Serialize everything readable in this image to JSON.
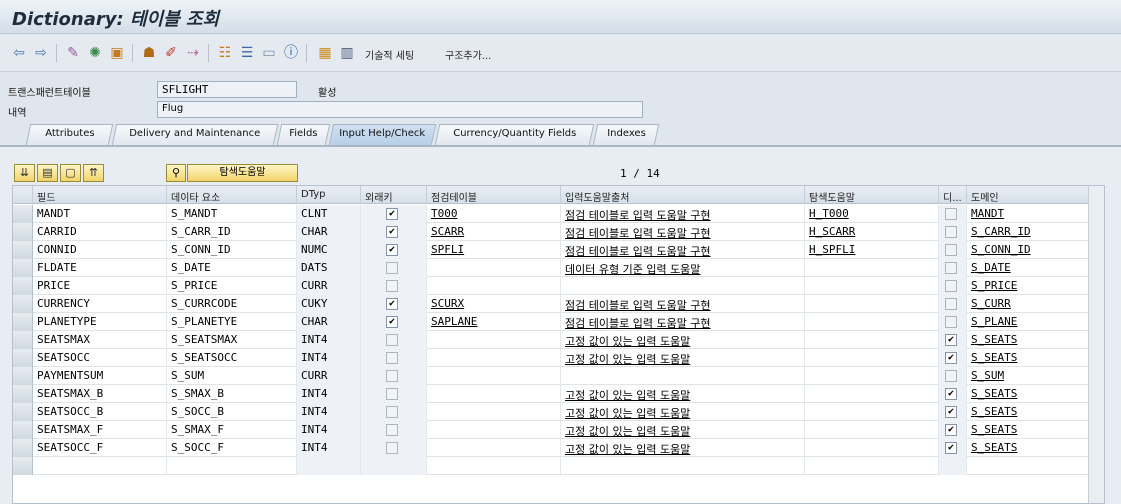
{
  "title": "Dictionary: 테이블 조회",
  "toolbar": {
    "items": [
      "back",
      "forward",
      "display-change",
      "activate",
      "where-used",
      "other-object",
      "check",
      "navigate",
      "object-list",
      "hierarchy",
      "info",
      "technical-settings",
      "append-structure"
    ],
    "tech_settings_label": "기술적 세팅",
    "append_structure_label": "구조추가..."
  },
  "header": {
    "transparent_table_label": "트랜스패런트테이블",
    "table_name": "SFLIGHT",
    "status": "활성",
    "desc_label": "내역",
    "desc_value": "Flug"
  },
  "tabs": [
    {
      "label": "Attributes"
    },
    {
      "label": "Delivery and Maintenance"
    },
    {
      "label": "Fields"
    },
    {
      "label": "Input Help/Check",
      "active": true
    },
    {
      "label": "Currency/Quantity Fields"
    },
    {
      "label": "Indexes"
    }
  ],
  "panel": {
    "search_help_label": "탐색도움말",
    "pager": "1 / 14"
  },
  "grid": {
    "columns": [
      "필드",
      "데이타 요소",
      "DTyp",
      "외래키",
      "점검테이블",
      "입력도움말출처",
      "탐색도움말",
      "디...",
      "도메인"
    ],
    "rows": [
      {
        "field": "MANDT",
        "element": "S_MANDT",
        "dtyp": "CLNT",
        "fk": true,
        "check": "T000",
        "origin": "점검 테이블로 입력 도움말 구현",
        "searchhelp": "H_T000",
        "deflt": false,
        "domain": "MANDT"
      },
      {
        "field": "CARRID",
        "element": "S_CARR_ID",
        "dtyp": "CHAR",
        "fk": true,
        "check": "SCARR",
        "origin": "점검 테이블로 입력 도움말 구현",
        "searchhelp": "H_SCARR",
        "deflt": false,
        "domain": "S_CARR_ID"
      },
      {
        "field": "CONNID",
        "element": "S_CONN_ID",
        "dtyp": "NUMC",
        "fk": true,
        "check": "SPFLI",
        "origin": "점검 테이블로 입력 도움말 구현",
        "searchhelp": "H_SPFLI",
        "deflt": false,
        "domain": "S_CONN_ID"
      },
      {
        "field": "FLDATE",
        "element": "S_DATE",
        "dtyp": "DATS",
        "fk": false,
        "check": "",
        "origin": "데이터 유형 기준 입력 도움말",
        "searchhelp": "",
        "deflt": false,
        "domain": "S_DATE"
      },
      {
        "field": "PRICE",
        "element": "S_PRICE",
        "dtyp": "CURR",
        "fk": false,
        "check": "",
        "origin": "",
        "searchhelp": "",
        "deflt": false,
        "domain": "S_PRICE"
      },
      {
        "field": "CURRENCY",
        "element": "S_CURRCODE",
        "dtyp": "CUKY",
        "fk": true,
        "check": "SCURX",
        "origin": "점검 테이블로 입력 도움말 구현",
        "searchhelp": "",
        "deflt": false,
        "domain": "S_CURR"
      },
      {
        "field": "PLANETYPE",
        "element": "S_PLANETYE",
        "dtyp": "CHAR",
        "fk": true,
        "check": "SAPLANE",
        "origin": "점검 테이블로 입력 도움말 구현",
        "searchhelp": "",
        "deflt": false,
        "domain": "S_PLANE"
      },
      {
        "field": "SEATSMAX",
        "element": "S_SEATSMAX",
        "dtyp": "INT4",
        "fk": false,
        "check": "",
        "origin": "고정 값이 있는 입력 도움말",
        "searchhelp": "",
        "deflt": true,
        "domain": "S_SEATS"
      },
      {
        "field": "SEATSOCC",
        "element": "S_SEATSOCC",
        "dtyp": "INT4",
        "fk": false,
        "check": "",
        "origin": "고정 값이 있는 입력 도움말",
        "searchhelp": "",
        "deflt": true,
        "domain": "S_SEATS"
      },
      {
        "field": "PAYMENTSUM",
        "element": "S_SUM",
        "dtyp": "CURR",
        "fk": false,
        "check": "",
        "origin": "",
        "searchhelp": "",
        "deflt": false,
        "domain": "S_SUM"
      },
      {
        "field": "SEATSMAX_B",
        "element": "S_SMAX_B",
        "dtyp": "INT4",
        "fk": false,
        "check": "",
        "origin": "고정 값이 있는 입력 도움말",
        "searchhelp": "",
        "deflt": true,
        "domain": "S_SEATS"
      },
      {
        "field": "SEATSOCC_B",
        "element": "S_SOCC_B",
        "dtyp": "INT4",
        "fk": false,
        "check": "",
        "origin": "고정 값이 있는 입력 도움말",
        "searchhelp": "",
        "deflt": true,
        "domain": "S_SEATS"
      },
      {
        "field": "SEATSMAX_F",
        "element": "S_SMAX_F",
        "dtyp": "INT4",
        "fk": false,
        "check": "",
        "origin": "고정 값이 있는 입력 도움말",
        "searchhelp": "",
        "deflt": true,
        "domain": "S_SEATS"
      },
      {
        "field": "SEATSOCC_F",
        "element": "S_SOCC_F",
        "dtyp": "INT4",
        "fk": false,
        "check": "",
        "origin": "고정 값이 있는 입력 도움말",
        "searchhelp": "",
        "deflt": true,
        "domain": "S_SEATS"
      }
    ]
  }
}
